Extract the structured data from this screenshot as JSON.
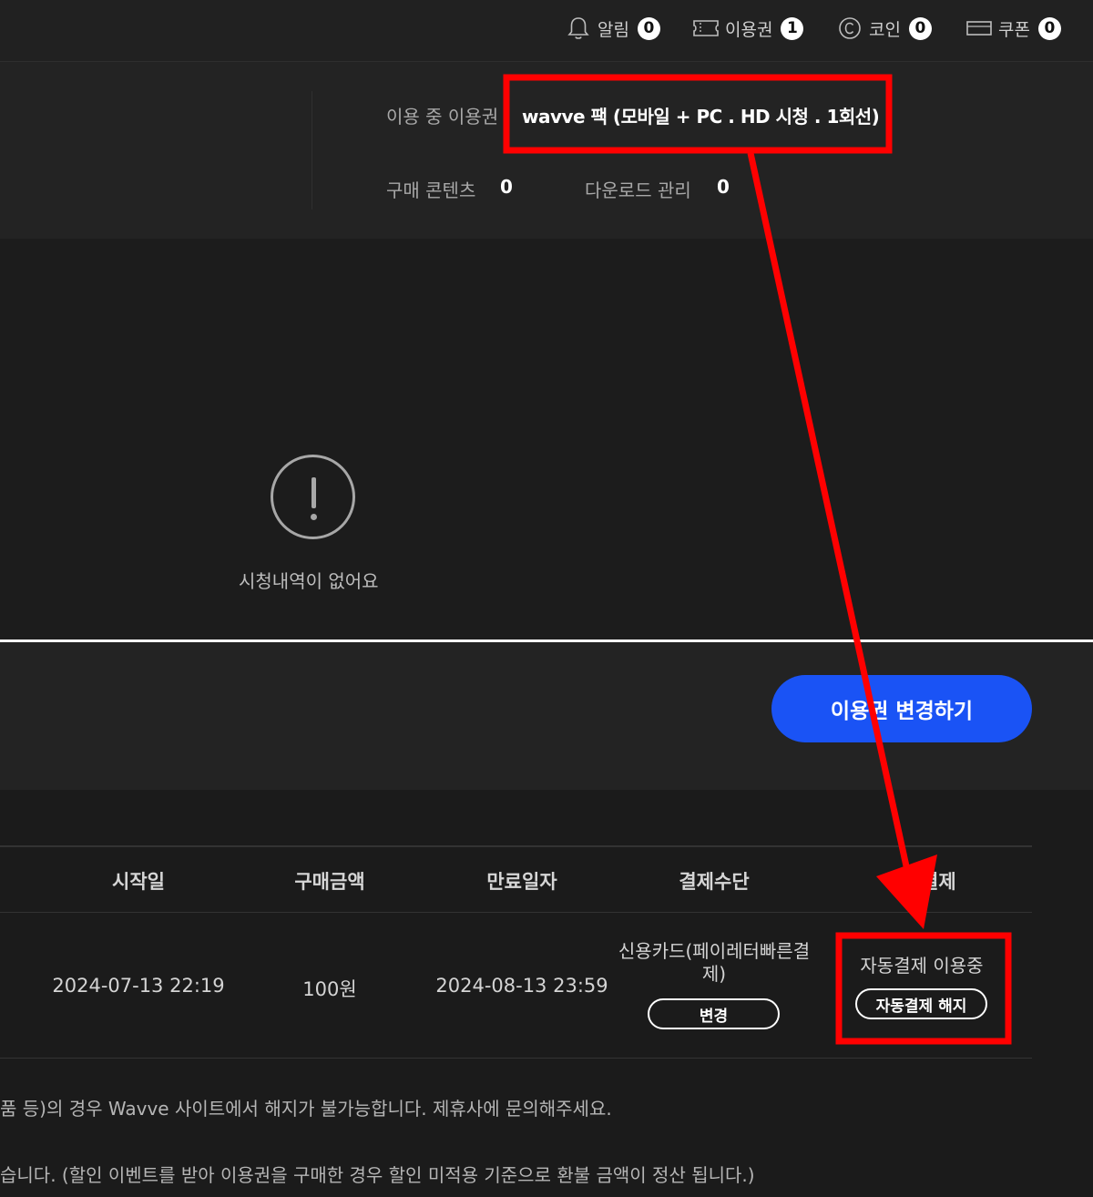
{
  "header": {
    "items": [
      {
        "label": "알림",
        "count": "0",
        "icon": "bell-icon"
      },
      {
        "label": "이용권",
        "count": "1",
        "icon": "ticket-icon"
      },
      {
        "label": "코인",
        "count": "0",
        "icon": "coin-icon"
      },
      {
        "label": "쿠폰",
        "count": "0",
        "icon": "coupon-icon"
      }
    ]
  },
  "summary": {
    "ticket_label": "이용 중 이용권",
    "ticket_name": "wavve 팩 (모바일 + PC . HD 시청 . 1회선)",
    "purchased_label": "구매 콘텐츠",
    "purchased_count": "0",
    "download_label": "다운로드 관리",
    "download_count": "0"
  },
  "history": {
    "empty_text": "시청내역이 없어요"
  },
  "actions": {
    "change_ticket_label": "이용권 변경하기"
  },
  "table": {
    "headers": [
      "시작일",
      "구매금액",
      "만료일자",
      "결제수단",
      "자동결제"
    ],
    "row": {
      "start_date": "2024-07-13 22:19",
      "amount": "100원",
      "end_date": "2024-08-13 23:59",
      "payment_method": "신용카드(페이레터빠른결제)",
      "change_label": "변경",
      "auto_status": "자동결제 이용중",
      "cancel_label": "자동결제 해지"
    }
  },
  "notices": [
    "품 등)의 경우 Wavve 사이트에서 해지가 불가능합니다. 제휴사에 문의해주세요.",
    "습니다. (할인 이벤트를 받아 이용권을 구매한 경우 할인 미적용 기준으로 환불 금액이 정산 됩니다.)"
  ],
  "colors": {
    "accent_blue": "#1a53f5",
    "annotation_red": "#ff0000",
    "background": "#1b1b1b"
  }
}
